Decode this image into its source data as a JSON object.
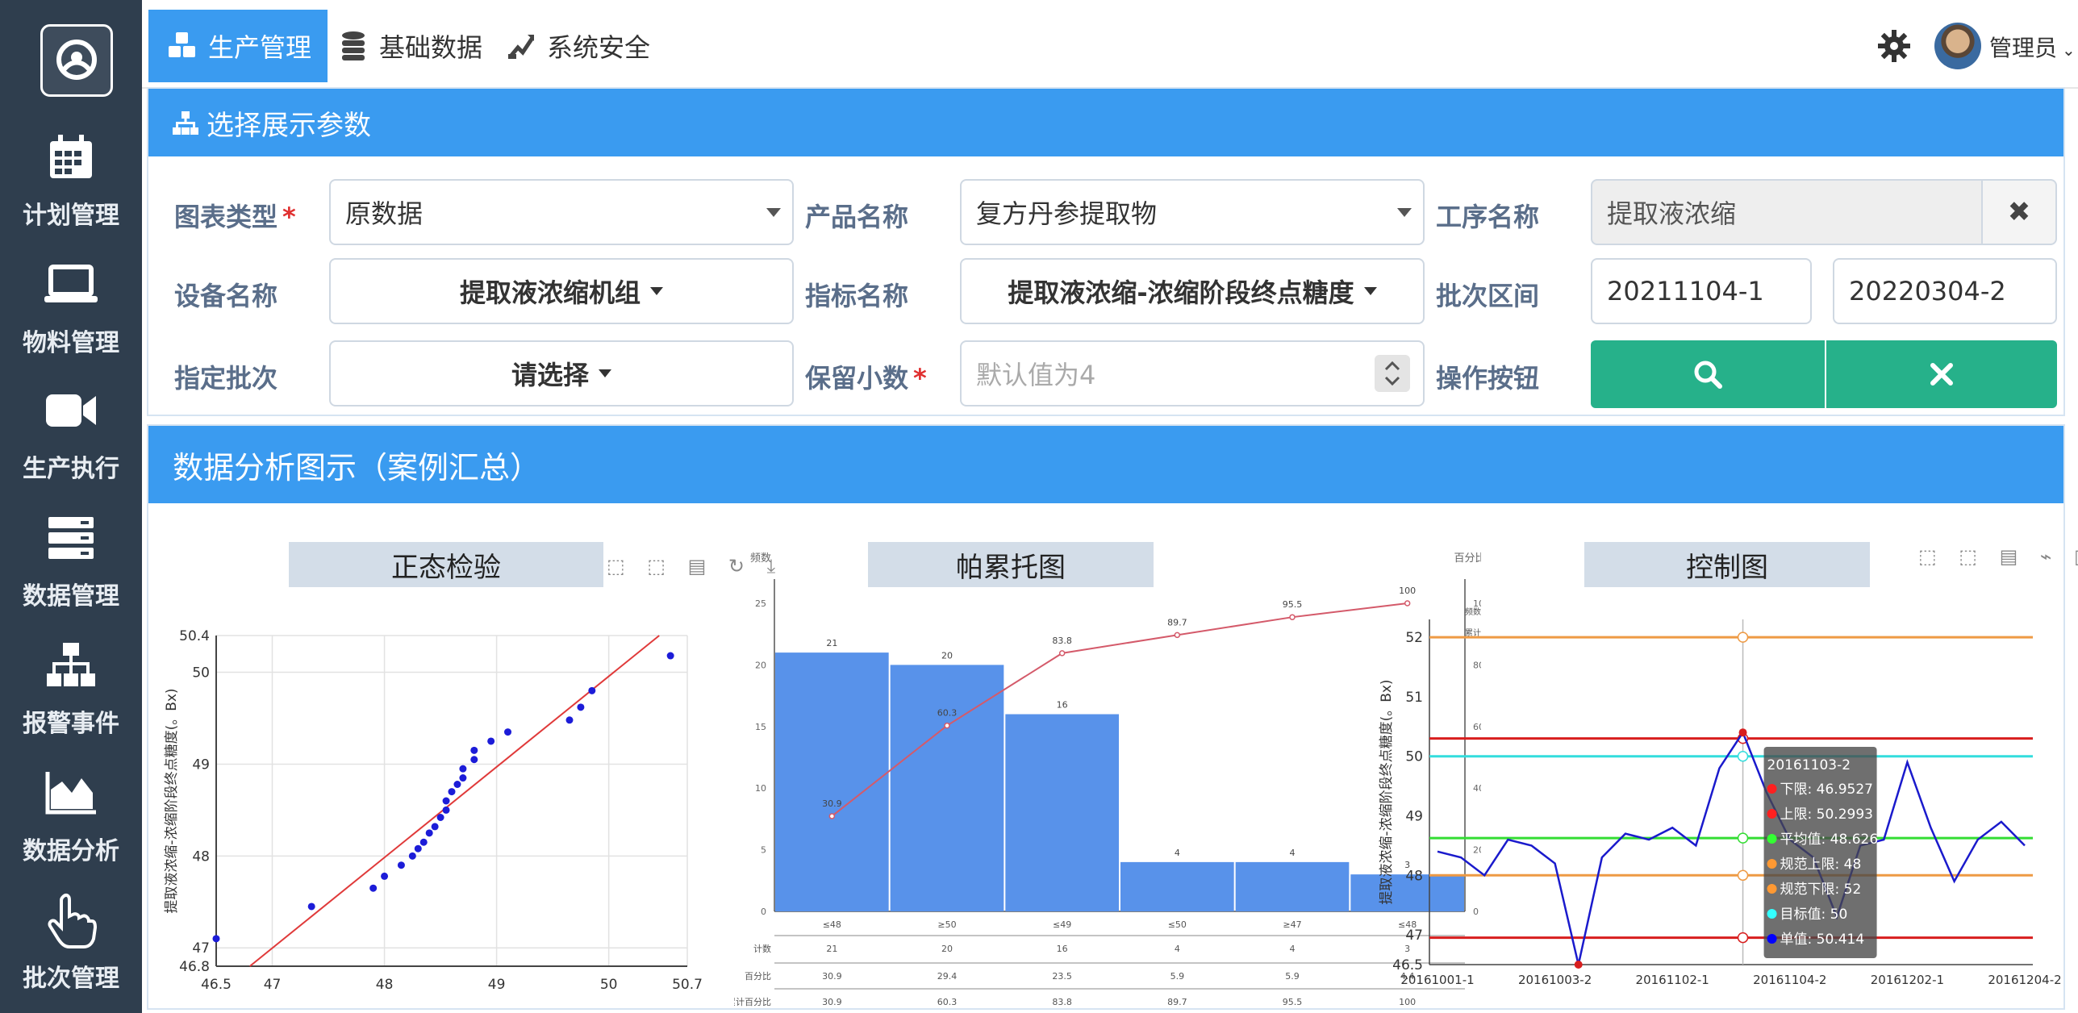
{
  "nav": {
    "tabs": [
      {
        "label": "生产管理",
        "icon": "cubes-icon",
        "active": true
      },
      {
        "label": "基础数据",
        "icon": "database-icon",
        "active": false
      },
      {
        "label": "系统安全",
        "icon": "security-icon",
        "active": false
      }
    ],
    "user": "管理员",
    "user_chevron": "⌄"
  },
  "sidebar": {
    "items": [
      {
        "label": "计划管理",
        "icon": "calendar-icon"
      },
      {
        "label": "物料管理",
        "icon": "laptop-icon"
      },
      {
        "label": "生产执行",
        "icon": "video-camera-icon"
      },
      {
        "label": "数据管理",
        "icon": "server-icon"
      },
      {
        "label": "报警事件",
        "icon": "sitemap-icon"
      },
      {
        "label": "数据分析",
        "icon": "area-chart-icon"
      },
      {
        "label": "批次管理",
        "icon": "hand-pointer-icon"
      }
    ]
  },
  "params": {
    "title": "选择展示参数",
    "chart_type_label": "图表类型",
    "chart_type_value": "原数据",
    "product_label": "产品名称",
    "product_value": "复方丹参提取物",
    "process_label": "工序名称",
    "process_value": "提取液浓缩",
    "device_label": "设备名称",
    "device_value": "提取液浓缩机组",
    "index_label": "指标名称",
    "index_value": "提取液浓缩-浓缩阶段终点糖度",
    "batch_range_label": "批次区间",
    "batch_from": "20211104-1",
    "batch_to": "20220304-2",
    "batch_label": "指定批次",
    "batch_value": "请选择",
    "decimals_label": "保留小数",
    "decimals_placeholder": "默认值为4",
    "ops_label": "操作按钮",
    "required_mark": "*",
    "clear_mark": "✖"
  },
  "analysis": {
    "title": "数据分析图示（案例汇总）",
    "toolbox_icons": "⬚ ⬚ ▤ ↻ ⤓",
    "toolbox_icons_right": "⬚ ⬚ ▤ ⌁ ▥ ↻"
  },
  "chart_data": [
    {
      "type": "scatter",
      "title": "正态检验",
      "ylabel": "提取液浓缩-浓缩阶段终点糖度(。Bx)",
      "xlim": [
        46.5,
        50.7
      ],
      "ylim": [
        46.8,
        50.4
      ],
      "xticks": [
        "46.5",
        "47",
        "48",
        "49",
        "50",
        "50.7"
      ],
      "yticks": [
        "46.8",
        "47",
        "48",
        "49",
        "50",
        "50.4"
      ],
      "points": [
        [
          46.5,
          47.1
        ],
        [
          47.35,
          47.45
        ],
        [
          47.9,
          47.65
        ],
        [
          48.0,
          47.78
        ],
        [
          48.15,
          47.9
        ],
        [
          48.25,
          48.0
        ],
        [
          48.3,
          48.08
        ],
        [
          48.35,
          48.15
        ],
        [
          48.4,
          48.25
        ],
        [
          48.45,
          48.32
        ],
        [
          48.5,
          48.42
        ],
        [
          48.55,
          48.5
        ],
        [
          48.55,
          48.6
        ],
        [
          48.6,
          48.7
        ],
        [
          48.65,
          48.78
        ],
        [
          48.7,
          48.85
        ],
        [
          48.7,
          48.95
        ],
        [
          48.8,
          49.05
        ],
        [
          48.8,
          49.15
        ],
        [
          48.95,
          49.25
        ],
        [
          49.1,
          49.35
        ],
        [
          49.65,
          49.48
        ],
        [
          49.75,
          49.62
        ],
        [
          49.85,
          49.8
        ],
        [
          50.55,
          50.18
        ]
      ],
      "fit_line": [
        [
          46.8,
          46.8
        ],
        [
          50.45,
          50.4
        ]
      ],
      "grid": true
    },
    {
      "type": "bar",
      "title": "帕累托图",
      "ylabel": "频数",
      "ylabel_right": "百分比",
      "legend": [
        "频数",
        "累计"
      ],
      "categories": [
        "<=48",
        ">50",
        "<=49",
        "<=50",
        ">47",
        "<=48"
      ],
      "category_labels": [
        "≤48",
        "≥50",
        "≤49",
        "≤50",
        "≥47",
        "≤48"
      ],
      "values": [
        21,
        20,
        16,
        4,
        4,
        3
      ],
      "cumulative": [
        30.9,
        60.3,
        83.8,
        89.7,
        95.5,
        100
      ],
      "ylim": [
        0,
        25
      ],
      "ylim_right": [
        0,
        100
      ],
      "table_row_labels": [
        "计数",
        "百分比",
        "累计百分比"
      ],
      "table": [
        [
          "21",
          "20",
          "16",
          "4",
          "4",
          "3"
        ],
        [
          "30.9",
          "29.4",
          "23.5",
          "5.9",
          "5.9",
          "4.4"
        ],
        [
          "30.9",
          "60.3",
          "83.8",
          "89.7",
          "95.5",
          "100"
        ]
      ]
    },
    {
      "type": "line",
      "title": "控制图",
      "ylabel": "提取液浓缩-浓缩阶段终点糖度(。Bx)",
      "ylim": [
        46.5,
        52.3
      ],
      "yticks": [
        "46.5",
        "47",
        "48",
        "49",
        "50",
        "51",
        "52"
      ],
      "xticks": [
        "20161001-1",
        "20161003-2",
        "20161102-1",
        "20161104-2",
        "20161202-1",
        "20161204-2"
      ],
      "series": [
        {
          "name": "单值",
          "color": "#1a1acc",
          "values": [
            48.4,
            48.3,
            48.0,
            48.6,
            48.5,
            48.2,
            46.5,
            48.3,
            48.7,
            48.6,
            48.8,
            48.5,
            49.8,
            50.4,
            49.4,
            48.6,
            48.3,
            47.3,
            48.5,
            48.6,
            49.9,
            48.8,
            47.9,
            48.6,
            48.9,
            48.5
          ]
        },
        {
          "name": "下限",
          "color": "#d81e1e",
          "value": 46.9527
        },
        {
          "name": "上限",
          "color": "#d81e1e",
          "value": 50.2993
        },
        {
          "name": "平均值",
          "color": "#33dd33",
          "value": 48.626
        },
        {
          "name": "规范上限",
          "color": "#ee9a44",
          "value": 48
        },
        {
          "name": "规范下限",
          "color": "#ee9a44",
          "value": 52
        },
        {
          "name": "目标值",
          "color": "#33dddd",
          "value": 50
        }
      ],
      "tooltip": {
        "batch": "20161103-2",
        "rows": [
          {
            "label": "下限: 46.9527",
            "color": "#ff2020"
          },
          {
            "label": "上限: 50.2993",
            "color": "#ff2020"
          },
          {
            "label": "平均值: 48.626",
            "color": "#33ff33"
          },
          {
            "label": "规范上限: 48",
            "color": "#ff9933"
          },
          {
            "label": "规范下限: 52",
            "color": "#ff9933"
          },
          {
            "label": "目标值: 50",
            "color": "#33ffff"
          },
          {
            "label": "单值: 50.414",
            "color": "#0000ff"
          }
        ]
      }
    }
  ]
}
